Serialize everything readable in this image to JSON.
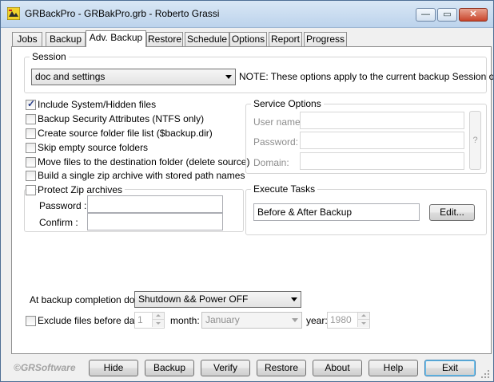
{
  "window": {
    "title": "GRBackPro - GRBakPro.grb - Roberto Grassi",
    "minimize": "—",
    "maximize": "▭",
    "close": "✕"
  },
  "tabs": [
    "Jobs",
    "Backup",
    "Adv. Backup",
    "Restore",
    "Schedule",
    "Options",
    "Report",
    "Progress"
  ],
  "active_tab": "Adv. Backup",
  "session": {
    "group_label": "Session",
    "selected": "doc and settings",
    "note": "NOTE: These options apply to the current backup Session only."
  },
  "options": [
    {
      "label": "Include System/Hidden files",
      "checked": true
    },
    {
      "label": "Backup Security Attributes (NTFS only)",
      "checked": false
    },
    {
      "label": "Create source folder file list ($backup.dir)",
      "checked": false
    },
    {
      "label": "Skip empty source folders",
      "checked": false
    },
    {
      "label": "Move files to the destination folder (delete source)",
      "checked": false
    },
    {
      "label": "Build a single zip archive with stored path names",
      "checked": false
    }
  ],
  "protect_zip": {
    "label": "Protect Zip archives",
    "checked": false,
    "password_label": "Password :",
    "password_value": "",
    "confirm_label": "Confirm :",
    "confirm_value": ""
  },
  "service_options": {
    "group_label": "Service Options",
    "user_label": "User name:",
    "password_label": "Password:",
    "domain_label": "Domain:",
    "user_value": "",
    "password_value": "",
    "domain_value": "",
    "help": "?"
  },
  "execute_tasks": {
    "group_label": "Execute Tasks",
    "value": "Before & After Backup",
    "edit_label": "Edit..."
  },
  "completion": {
    "label": "At backup completion do:",
    "selected": "Shutdown && Power OFF"
  },
  "exclude": {
    "label": "Exclude files before day:",
    "checked": false,
    "day": "1",
    "month_label": "month:",
    "month": "January",
    "year_label": "year:",
    "year": "1980"
  },
  "footer": {
    "logo": "©GRSoftware",
    "buttons": [
      "Hide",
      "Backup",
      "Verify",
      "Restore",
      "About",
      "Help",
      "Exit"
    ]
  },
  "colors": {
    "window_border": "#4f6f95",
    "titlebar": "#bcd3ec",
    "default_button": "#3c7fb1"
  }
}
